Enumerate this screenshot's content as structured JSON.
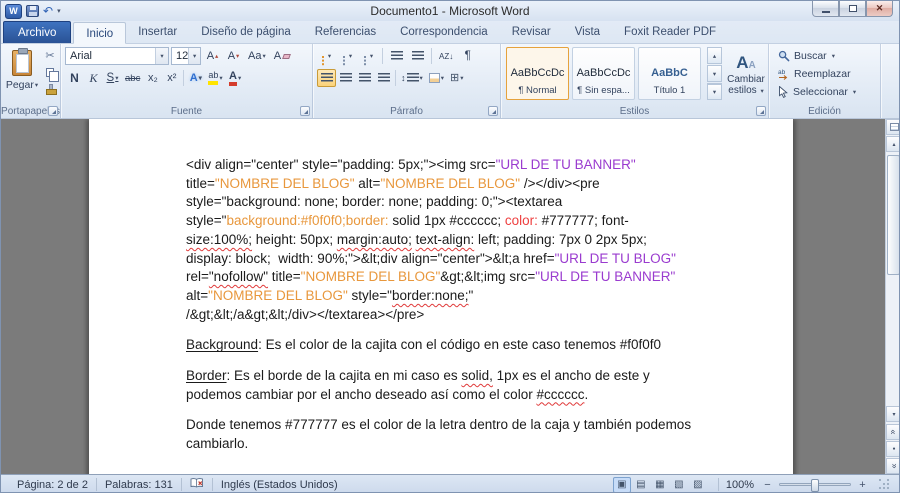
{
  "window": {
    "title": "Documento1 - Microsoft Word"
  },
  "icons": {
    "dropdown": "▾",
    "up_arrow": "▴",
    "down_arrow": "▼",
    "scroll_up": "▲",
    "close": "✕",
    "cut": "✂",
    "undo": "↶",
    "pilcrow": "¶",
    "sort": "AZ↓",
    "borders": "⊞",
    "spacing": "↕",
    "zoom_out": "−",
    "zoom_in": "+",
    "chevron": "«",
    "browse_dot": "●"
  },
  "tabs": [
    {
      "id": "archivo",
      "label": "Archivo",
      "file": true
    },
    {
      "id": "inicio",
      "label": "Inicio",
      "active": true
    },
    {
      "id": "insertar",
      "label": "Insertar"
    },
    {
      "id": "diseno-de-pagina",
      "label": "Diseño de página"
    },
    {
      "id": "referencias",
      "label": "Referencias"
    },
    {
      "id": "correspondencia",
      "label": "Correspondencia"
    },
    {
      "id": "revisar",
      "label": "Revisar"
    },
    {
      "id": "vista",
      "label": "Vista"
    },
    {
      "id": "foxit-reader-pdf",
      "label": "Foxit Reader PDF"
    }
  ],
  "ribbon": {
    "clipboard": {
      "label": "Portapapeles",
      "paste": "Pegar"
    },
    "font": {
      "label": "Fuente",
      "family": "Arial",
      "size": "12",
      "bold": "N",
      "italic": "K",
      "underline": "S",
      "strike": "abc",
      "subscript": "x₂",
      "superscript": "x²",
      "case": "Aa",
      "grow": "A",
      "shrink": "A",
      "clear": "A",
      "effects": "A",
      "highlight": "ab",
      "color": "A"
    },
    "paragraph": {
      "label": "Párrafo"
    },
    "styles": {
      "label": "Estilos",
      "change": "Cambiar estilos",
      "items": [
        {
          "preview": "AaBbCcDc",
          "name": "¶ Normal",
          "selected": true
        },
        {
          "preview": "AaBbCcDc",
          "name": "¶ Sin espa..."
        },
        {
          "preview": "AaBbC",
          "name": "Título 1",
          "blue": true
        }
      ]
    },
    "editing": {
      "label": "Edición",
      "find": "Buscar",
      "replace": "Reemplazar",
      "select": "Seleccionar"
    }
  },
  "document": {
    "code_lines": [
      [
        {
          "t": "<div align=\"center\" style=\"padding: 5px;\"><img src=",
          "c": "k"
        },
        {
          "t": "\"URL DE TU BANNER\"",
          "c": "p"
        }
      ],
      [
        {
          "t": "title=",
          "c": "k"
        },
        {
          "t": "\"NOMBRE DEL BLOG\"",
          "c": "o"
        },
        {
          "t": " alt=",
          "c": "k"
        },
        {
          "t": "\"NOMBRE DEL BLOG\"",
          "c": "o"
        },
        {
          "t": " /></div><pre",
          "c": "k"
        }
      ],
      [
        {
          "t": "style=\"background: none; border: none; padding: 0;\"><textarea",
          "c": "k"
        }
      ],
      [
        {
          "t": "style=\"",
          "c": "k"
        },
        {
          "t": "background:#f0f0f0;border:",
          "c": "o"
        },
        {
          "t": " solid 1px #cccccc; ",
          "c": "k"
        },
        {
          "t": "color:",
          "c": "r"
        },
        {
          "t": " #777777; font-",
          "c": "k"
        }
      ],
      [
        {
          "t": "size:100%;",
          "c": "k",
          "w": true
        },
        {
          "t": " height: 50px; ",
          "c": "k"
        },
        {
          "t": "margin:auto;",
          "c": "k",
          "w": true
        },
        {
          "t": " ",
          "c": "k"
        },
        {
          "t": "text-align:",
          "c": "k",
          "w": true
        },
        {
          "t": " left; padding: 7px 0 2px 5px;",
          "c": "k"
        }
      ],
      [
        {
          "t": "display: block;  width: 90%;\">&lt;div align=\"center\">&lt;a href=",
          "c": "k"
        },
        {
          "t": "\"URL DE TU BLOG\"",
          "c": "p"
        }
      ],
      [
        {
          "t": "rel=",
          "c": "k"
        },
        {
          "t": "\"nofollow\"",
          "c": "k",
          "w": true
        },
        {
          "t": " title=",
          "c": "k"
        },
        {
          "t": "\"NOMBRE DEL BLOG\"",
          "c": "o"
        },
        {
          "t": "&gt;&lt;img src=",
          "c": "k"
        },
        {
          "t": "\"URL DE TU BANNER\"",
          "c": "p"
        }
      ],
      [
        {
          "t": "alt=",
          "c": "k"
        },
        {
          "t": "\"NOMBRE DEL BLOG\"",
          "c": "o"
        },
        {
          "t": " style=\"",
          "c": "k"
        },
        {
          "t": "border:none;",
          "c": "k",
          "w": true
        },
        {
          "t": "\"",
          "c": "k"
        }
      ],
      [
        {
          "t": "/&gt;&lt;/a&gt;&lt;/div></textarea></pre>",
          "c": "k"
        }
      ]
    ],
    "paragraphs": [
      [
        {
          "t": "Background",
          "u": true
        },
        {
          "t": ": Es el color de la cajita con el código en este caso tenemos #f0f0f0"
        }
      ],
      [
        {
          "t": "Border",
          "u": true
        },
        {
          "t": ": Es el borde de la cajita en mi caso es "
        },
        {
          "t": "solid,",
          "w": true
        },
        {
          "t": " 1px es el ancho de este y podemos cambiar por el ancho deseado así como el color "
        },
        {
          "t": "#cccccc",
          "w": true
        },
        {
          "t": "."
        }
      ],
      [
        {
          "t": "Donde tenemos #777777 es el color de la letra dentro de la caja y también podemos cambiarlo."
        }
      ]
    ]
  },
  "statusbar": {
    "page": "Página: 2 de 2",
    "words": "Palabras: 131",
    "language": "Inglés (Estados Unidos)",
    "zoom_level": "100%",
    "view_buttons": [
      {
        "name": "print-layout-view-button",
        "glyph": "▣",
        "active": true
      },
      {
        "name": "full-screen-reading-view-button",
        "glyph": "▤"
      },
      {
        "name": "web-layout-view-button",
        "glyph": "▦"
      },
      {
        "name": "outline-view-button",
        "glyph": "▧"
      },
      {
        "name": "draft-view-button",
        "glyph": "▨"
      }
    ]
  },
  "colors": {
    "code_purple": "#9a3bcf",
    "code_orange": "#e8973c",
    "code_red": "#ee4040",
    "squiggle_red": "#e03a3a",
    "accent_orange": "#fbd37a"
  }
}
